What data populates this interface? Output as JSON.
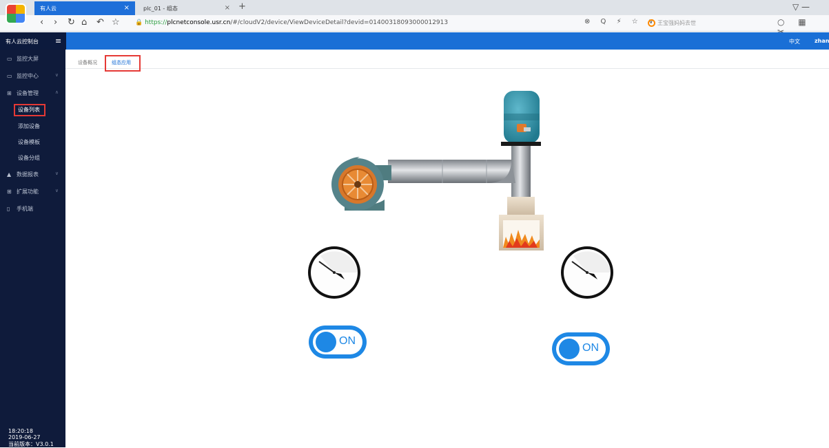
{
  "browser": {
    "tabs": [
      {
        "label": "有人云",
        "active": true
      },
      {
        "label": "plc_01 - 组态",
        "active": false
      }
    ],
    "new_tab": "+",
    "url_prefix": "https://",
    "url_host": "plcnetconsole.usr.cn",
    "url_path": "/#/cloudV2/device/ViewDeviceDetail?devid=01400318093000012913",
    "search_placeholder": "王宝强妈妈去世",
    "tool_icons": "⊗ Q ⚡ ☆ ∨",
    "right_icons": "○ ▦ ✂",
    "win_controls": "▽ —"
  },
  "header": {
    "brand": "有人云控制台",
    "menu_icon": "≡",
    "lang": "中文",
    "user": "zhang"
  },
  "sidebar": {
    "items": [
      {
        "icon": "▭",
        "label": "监控大屏"
      },
      {
        "icon": "▭",
        "label": "监控中心",
        "arrow": "∨"
      },
      {
        "icon": "⊞",
        "label": "设备管理",
        "arrow": "∧"
      },
      {
        "label": "设备列表"
      },
      {
        "label": "添加设备"
      },
      {
        "label": "设备模板"
      },
      {
        "label": "设备分组"
      },
      {
        "icon": "▲",
        "label": "数据报表",
        "arrow": "∨"
      },
      {
        "icon": "⊞",
        "label": "扩展功能",
        "arrow": "∨"
      },
      {
        "icon": "▯",
        "label": "手机端"
      }
    ],
    "time": "18:20:18",
    "date": "2019-06-27",
    "version": "当前版本：V3.0.1"
  },
  "content": {
    "tabs": [
      {
        "label": "设备概况"
      },
      {
        "label": "组态应用",
        "selected": true
      }
    ],
    "toggles": [
      {
        "label": "ON",
        "state": "on"
      },
      {
        "label": "ON",
        "state": "on"
      }
    ]
  },
  "colors": {
    "header_blue": "#1a6fd6",
    "sidebar_bg": "#0f1b3b",
    "highlight_red": "#e53935",
    "toggle_blue": "#1e88e5"
  }
}
